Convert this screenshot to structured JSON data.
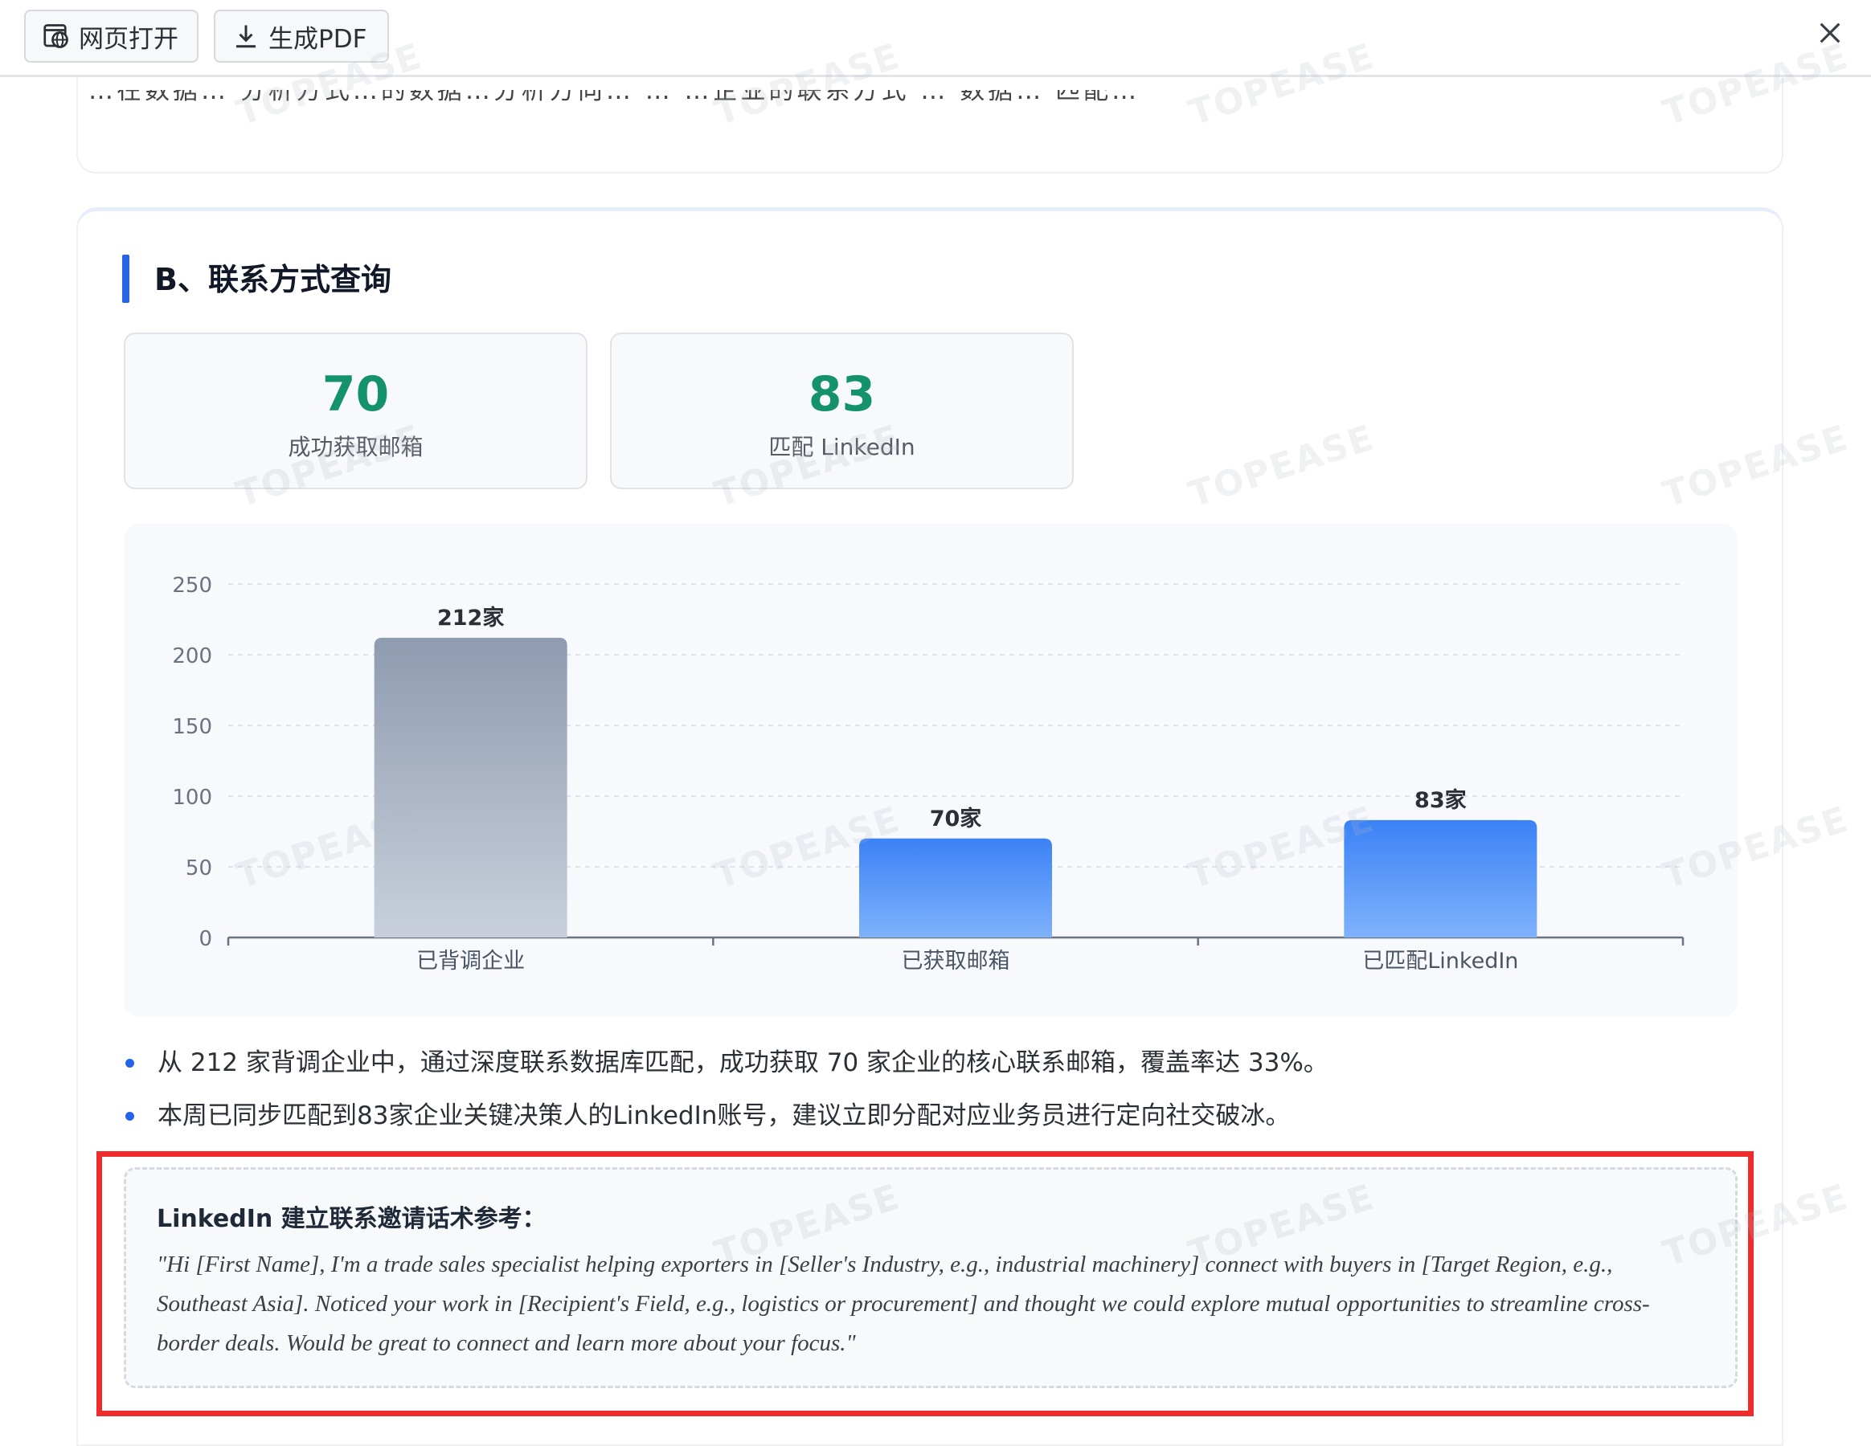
{
  "toolbar": {
    "open_label": "网页打开",
    "pdf_label": "生成PDF",
    "icons": {
      "open": "browser-globe-icon",
      "pdf": "download-icon",
      "close": "close-icon"
    }
  },
  "previous_section": {
    "cut_text": "…在数据… 分析方式…的数据…分析方向… … …企业的联系方式 … 数据… 匹配…"
  },
  "section": {
    "title": "B、联系方式查询",
    "accent_color": "#2563eb",
    "stats": [
      {
        "value": "70",
        "label": "成功获取邮箱"
      },
      {
        "value": "83",
        "label": "匹配 LinkedIn"
      }
    ],
    "stat_value_color": "#14936a"
  },
  "chart_data": {
    "type": "bar",
    "categories": [
      "已背调企业",
      "已获取邮箱",
      "已匹配LinkedIn"
    ],
    "values": [
      212,
      70,
      83
    ],
    "data_labels": [
      "212家",
      "70家",
      "83家"
    ],
    "ylim": [
      0,
      250
    ],
    "yticks": [
      0,
      50,
      100,
      150,
      200,
      250
    ],
    "grid": true,
    "bar_colors": [
      {
        "top": "#8e9bb0",
        "bottom": "#c9d0dc"
      },
      {
        "top": "#3b82f6",
        "bottom": "#7fb2fb"
      },
      {
        "top": "#3b82f6",
        "bottom": "#7fb2fb"
      }
    ]
  },
  "bullets": [
    "从 212 家背调企业中，通过深度联系数据库匹配，成功获取 70 家企业的核心联系邮箱，覆盖率达 33%。",
    "本周已同步匹配到83家企业关键决策人的LinkedIn账号，建议立即分配对应业务员进行定向社交破冰。"
  ],
  "reference": {
    "title": "LinkedIn 建立联系邀请话术参考：",
    "quote": "\"Hi [First Name], I'm a trade sales specialist helping exporters in [Seller's Industry, e.g., industrial machinery] connect with buyers in [Target Region, e.g., Southeast Asia]. Noticed your work in [Recipient's Field, e.g., logistics or procurement] and thought we could explore mutual opportunities to streamline cross-border deals. Would be great to connect and learn more about your focus.\"",
    "highlight_color": "#ef2b2b"
  },
  "watermark": "TOPEASE"
}
